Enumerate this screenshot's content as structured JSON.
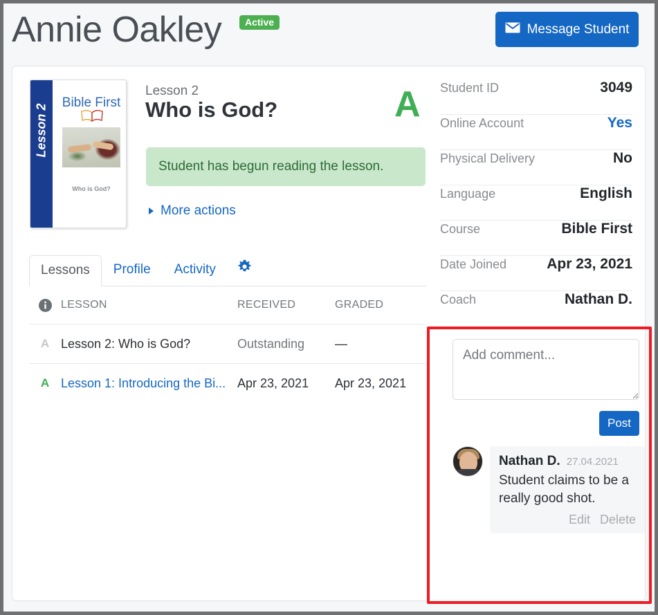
{
  "header": {
    "student_name": "Annie Oakley",
    "status_badge": "Active",
    "message_button": "Message Student"
  },
  "lesson_cover": {
    "spine_label": "Lesson 2",
    "brand": "Bible First",
    "subtitle": "Who is God?"
  },
  "lesson_detail": {
    "eyebrow": "Lesson 2",
    "title": "Who is God?",
    "grade": "A",
    "status_message": "Student has begun reading the lesson.",
    "more_actions": "More actions"
  },
  "tabs": [
    {
      "label": "Lessons",
      "active": true
    },
    {
      "label": "Profile",
      "active": false
    },
    {
      "label": "Activity",
      "active": false
    }
  ],
  "lessons_table": {
    "columns": [
      "",
      "LESSON",
      "RECEIVED",
      "GRADED"
    ],
    "rows": [
      {
        "grade": "A",
        "lesson": "Lesson 2: Who is God?",
        "received": "Outstanding",
        "graded": "—"
      },
      {
        "grade": "A",
        "lesson": "Lesson 1: Introducing the Bi...",
        "received": "Apr 23, 2021",
        "graded": "Apr 23, 2021"
      }
    ]
  },
  "info_panel": [
    {
      "label": "Student ID",
      "value": "3049",
      "is_link": false
    },
    {
      "label": "Online Account",
      "value": "Yes",
      "is_link": true
    },
    {
      "label": "Physical Delivery",
      "value": "No",
      "is_link": false
    },
    {
      "label": "Language",
      "value": "English",
      "is_link": false
    },
    {
      "label": "Course",
      "value": "Bible First",
      "is_link": false
    },
    {
      "label": "Date Joined",
      "value": "Apr 23, 2021",
      "is_link": false
    },
    {
      "label": "Coach",
      "value": "Nathan D.",
      "is_link": false
    }
  ],
  "comments": {
    "input_placeholder": "Add comment...",
    "input_value": "",
    "post_label": "Post",
    "items": [
      {
        "author": "Nathan D.",
        "date": "27.04.2021",
        "text": "Student claims to be a really good shot.",
        "edit_label": "Edit",
        "delete_label": "Delete"
      }
    ]
  },
  "colors": {
    "primary_blue": "#1567c4",
    "active_green": "#4cb050",
    "grade_green": "#3fae54",
    "alert_green_bg": "#c9e7ca",
    "alert_green_text": "#2c6b37",
    "annotation_red": "#ee1b24"
  }
}
